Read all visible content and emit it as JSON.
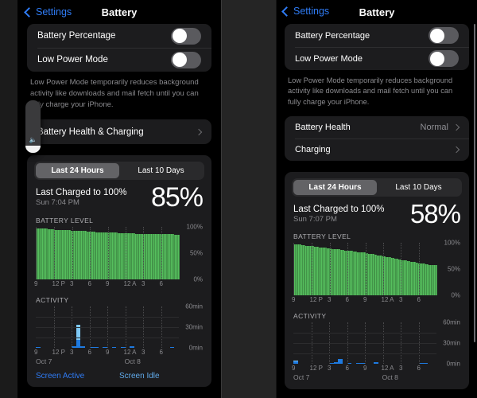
{
  "panels": [
    {
      "id": "left",
      "nav": {
        "back_label": "Settings",
        "title": "Battery"
      },
      "settings_rows": [
        {
          "label": "Battery Percentage",
          "control": "toggle",
          "state": "off"
        },
        {
          "label": "Low Power Mode",
          "control": "toggle",
          "state": "off"
        }
      ],
      "footnote": "Low Power Mode temporarily reduces background activity like downloads and mail fetch until you can fully charge your iPhone.",
      "link_rows": [
        {
          "label": "Battery Health & Charging",
          "value": "",
          "chevron": true
        }
      ],
      "usage": {
        "segments": [
          {
            "label": "Last 24 Hours",
            "selected": true
          },
          {
            "label": "Last 10 Days",
            "selected": false
          }
        ],
        "charged_title": "Last Charged to 100%",
        "charged_time": "Sun 7:04 PM",
        "charge_percent": "85%",
        "battery_level_header": "BATTERY LEVEL",
        "activity_header": "ACTIVITY",
        "legend": [
          {
            "label": "Screen Active",
            "color": "#2f7cf6"
          },
          {
            "label": "Screen Idle",
            "color": "#5fa8e8"
          }
        ]
      },
      "volume_hud": {
        "icon": "speaker-icon",
        "level_percent": 14
      }
    },
    {
      "id": "right",
      "nav": {
        "back_label": "Settings",
        "title": "Battery"
      },
      "settings_rows": [
        {
          "label": "Battery Percentage",
          "control": "toggle",
          "state": "off"
        },
        {
          "label": "Low Power Mode",
          "control": "toggle",
          "state": "off"
        }
      ],
      "footnote": "Low Power Mode temporarily reduces background activity like downloads and mail fetch until you can fully charge your iPhone.",
      "link_rows": [
        {
          "label": "Battery Health",
          "value": "Normal",
          "chevron": true
        },
        {
          "label": "Charging",
          "value": "",
          "chevron": true
        }
      ],
      "usage": {
        "segments": [
          {
            "label": "Last 24 Hours",
            "selected": true
          },
          {
            "label": "Last 10 Days",
            "selected": false
          }
        ],
        "charged_title": "Last Charged to 100%",
        "charged_time": "Sun 7:07 PM",
        "charge_percent": "58%",
        "battery_level_header": "BATTERY LEVEL",
        "activity_header": "ACTIVITY",
        "legend": []
      }
    }
  ],
  "colors": {
    "accent_blue": "#2f7cf6",
    "battery_green": "#56bf5e",
    "screen_active_blue": "#1e7ae0",
    "screen_idle_blue": "#7ec8f5",
    "card_bg": "#1c1c1e",
    "secondary_text": "#8a8a8e"
  },
  "chart_data": [
    {
      "id": "left-battery-level",
      "type": "area",
      "title": "BATTERY LEVEL",
      "xlabel": "",
      "ylabel": "",
      "ylim": [
        0,
        100
      ],
      "yticks": [
        0,
        50,
        100
      ],
      "ytick_labels": [
        "0%",
        "50%",
        "100%"
      ],
      "xticks": [
        "9",
        "12 P",
        "3",
        "6",
        "9",
        "12 A",
        "3",
        "6"
      ],
      "day_labels": [
        "Oct 7",
        "Oct 8"
      ],
      "grid": false,
      "values": [
        98,
        98,
        98,
        98,
        97,
        97,
        97,
        97,
        96,
        96,
        96,
        96,
        96,
        95,
        95,
        95,
        95,
        95,
        95,
        94,
        94,
        94,
        94,
        94,
        93,
        93,
        93,
        93,
        93,
        93,
        92,
        92,
        92,
        92,
        92,
        91,
        91,
        91,
        91,
        91,
        91,
        90,
        90,
        90,
        90,
        90,
        90,
        90,
        89,
        89,
        89,
        89,
        89,
        89,
        89,
        89,
        89,
        88,
        88,
        88,
        88,
        88,
        88,
        88,
        88,
        88,
        88,
        88,
        88,
        87,
        87,
        87,
        87,
        87,
        87,
        87,
        87,
        87,
        87,
        87,
        86,
        86,
        86,
        86,
        86,
        86,
        86,
        86,
        86,
        86,
        86,
        86,
        86,
        86,
        86,
        86,
        85,
        85,
        85,
        85
      ]
    },
    {
      "id": "left-activity",
      "type": "bar",
      "title": "ACTIVITY",
      "ylim": [
        0,
        60
      ],
      "yticks": [
        0,
        30,
        60
      ],
      "ytick_labels": [
        "0min",
        "30min",
        "60min"
      ],
      "xticks": [
        "9",
        "12 P",
        "3",
        "6",
        "9",
        "12 A",
        "3",
        "6"
      ],
      "day_labels": [
        "Oct 7",
        "Oct 8"
      ],
      "series": [
        {
          "name": "Screen Active",
          "color": "#1e7ae0",
          "values": [
            1.5,
            0,
            0,
            0,
            0,
            0,
            0,
            0,
            3,
            12,
            2,
            0,
            1,
            1,
            0,
            1,
            0,
            1,
            0,
            1,
            0,
            2,
            0,
            0,
            0,
            0,
            0,
            0,
            0,
            0,
            1.5,
            0
          ]
        },
        {
          "name": "Screen Idle",
          "color": "#7ec8f5",
          "values": [
            0,
            0,
            0,
            0,
            0,
            0,
            0,
            0,
            0,
            22,
            0,
            0,
            0,
            0,
            0,
            0,
            0,
            0,
            0,
            0,
            0,
            0,
            0,
            0,
            0,
            0,
            0,
            0,
            0,
            0,
            0,
            0
          ]
        }
      ]
    },
    {
      "id": "right-battery-level",
      "type": "area",
      "title": "BATTERY LEVEL",
      "ylim": [
        0,
        100
      ],
      "yticks": [
        0,
        50,
        100
      ],
      "ytick_labels": [
        "0%",
        "50%",
        "100%"
      ],
      "xticks": [
        "9",
        "12 P",
        "3",
        "6",
        "9",
        "12 A",
        "3",
        "6"
      ],
      "day_labels": [
        "Oct 7",
        "Oct 8"
      ],
      "grid": false,
      "values": [
        98,
        98,
        97,
        97,
        97,
        96,
        96,
        96,
        95,
        95,
        95,
        94,
        94,
        94,
        93,
        93,
        93,
        92,
        92,
        92,
        91,
        91,
        91,
        90,
        90,
        90,
        89,
        89,
        89,
        88,
        88,
        88,
        87,
        87,
        87,
        86,
        86,
        86,
        85,
        85,
        85,
        84,
        84,
        84,
        83,
        83,
        83,
        82,
        82,
        82,
        81,
        81,
        80,
        80,
        79,
        79,
        78,
        78,
        77,
        77,
        76,
        76,
        75,
        75,
        74,
        74,
        73,
        73,
        72,
        72,
        71,
        70,
        70,
        69,
        69,
        68,
        68,
        67,
        67,
        66,
        66,
        65,
        65,
        64,
        64,
        63,
        63,
        62,
        62,
        61,
        61,
        61,
        60,
        60,
        59,
        59,
        59,
        58,
        58,
        58
      ]
    },
    {
      "id": "right-activity",
      "type": "bar",
      "title": "ACTIVITY",
      "ylim": [
        0,
        60
      ],
      "yticks": [
        0,
        30,
        60
      ],
      "ytick_labels": [
        "0min",
        "30min",
        "60min"
      ],
      "xticks": [
        "9",
        "12 P",
        "3",
        "6",
        "9",
        "12 A",
        "3",
        "6"
      ],
      "day_labels": [
        "Oct 7",
        "Oct 8"
      ],
      "series": [
        {
          "name": "Screen Active",
          "color": "#1e7ae0",
          "values": [
            4,
            0,
            0,
            0,
            0,
            0,
            0,
            0,
            2,
            3,
            7,
            0,
            2,
            0,
            2,
            2,
            0,
            0,
            3,
            0,
            0,
            0,
            0,
            0,
            0,
            0,
            0,
            0,
            2,
            2,
            0,
            0
          ]
        },
        {
          "name": "Screen Idle",
          "color": "#7ec8f5",
          "values": [
            1.5,
            0,
            0,
            0,
            0,
            0,
            0,
            0,
            0,
            0,
            0,
            0,
            0,
            0,
            0,
            0,
            0,
            0,
            0,
            0,
            0,
            0,
            0,
            0,
            0,
            0,
            0,
            0,
            0,
            0,
            0,
            0
          ]
        }
      ]
    }
  ]
}
